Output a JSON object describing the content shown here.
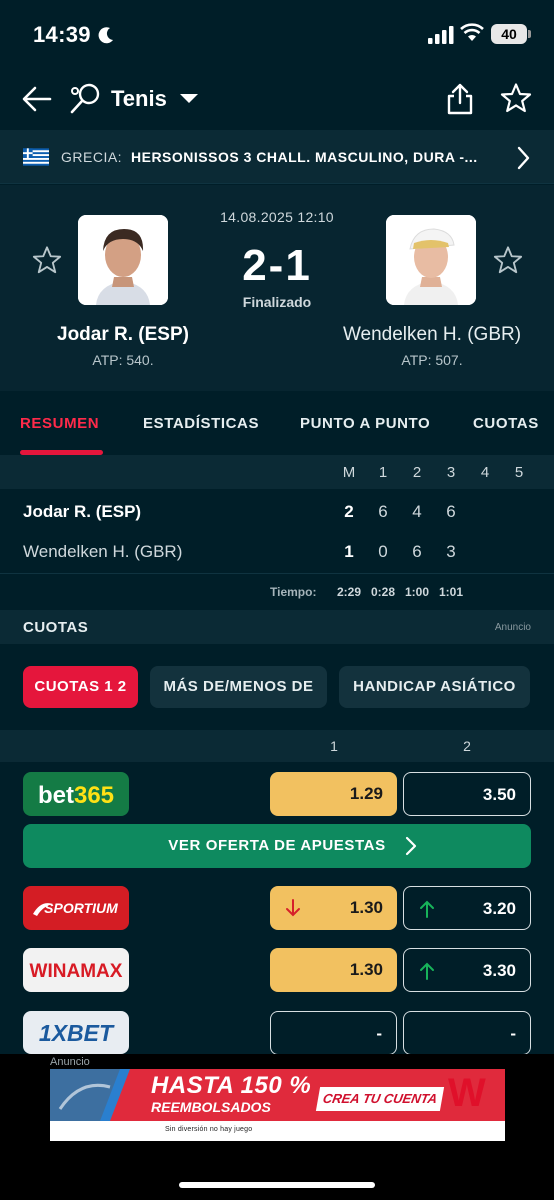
{
  "status_bar": {
    "time": "14:39",
    "battery": "40"
  },
  "header": {
    "title": "Tenis"
  },
  "league": {
    "country": "GRECIA:",
    "name": "HERSONISSOS 3 CHALL. MASCULINO, DURA -..."
  },
  "match": {
    "datetime": "14.08.2025 12:10",
    "score": "2-1",
    "status": "Finalizado",
    "home": {
      "name": "Jodar R. (ESP)",
      "rank": "ATP: 540."
    },
    "away": {
      "name": "Wendelken H. (GBR)",
      "rank": "ATP: 507."
    }
  },
  "tabs": [
    "RESUMEN",
    "ESTADÍSTICAS",
    "PUNTO A PUNTO",
    "CUOTAS"
  ],
  "score_table": {
    "columns": [
      "M",
      "1",
      "2",
      "3",
      "4",
      "5"
    ],
    "home": {
      "name": "Jodar R. (ESP)",
      "values": [
        "2",
        "6",
        "4",
        "6",
        "",
        ""
      ]
    },
    "away": {
      "name": "Wendelken H. (GBR)",
      "values": [
        "1",
        "0",
        "6",
        "3",
        "",
        ""
      ]
    },
    "time_label": "Tiempo:",
    "times": [
      "2:29",
      "0:28",
      "1:00",
      "1:01"
    ]
  },
  "odds": {
    "title": "CUOTAS",
    "ad_label": "Anuncio",
    "filters": [
      "CUOTAS 1 2",
      "MÁS DE/MENOS DE",
      "HANDICAP ASIÁTICO"
    ],
    "col1": "1",
    "col2": "2",
    "cta": "VER OFERTA DE APUESTAS",
    "bookies": [
      {
        "name": "bet365",
        "odd1": "1.29",
        "odd2": "3.50"
      },
      {
        "name": "SPORTIUM",
        "odd1": "1.30",
        "odd2": "3.20"
      },
      {
        "name": "WINAMAX",
        "odd1": "1.30",
        "odd2": "3.30"
      },
      {
        "name": "1XBET",
        "odd1": "-",
        "odd2": "-"
      }
    ]
  },
  "ad": {
    "label": "Anuncio",
    "headline": "HASTA 150 %",
    "subline": "REEMBOLSADOS",
    "cta": "CREA TU CUENTA",
    "logo": "W",
    "small": "Sin diversión no hay juego"
  },
  "colors": {
    "accent": "#e5163c",
    "background": "#001e28",
    "highlight": "#f2c160",
    "cta": "#0e8a5f"
  }
}
